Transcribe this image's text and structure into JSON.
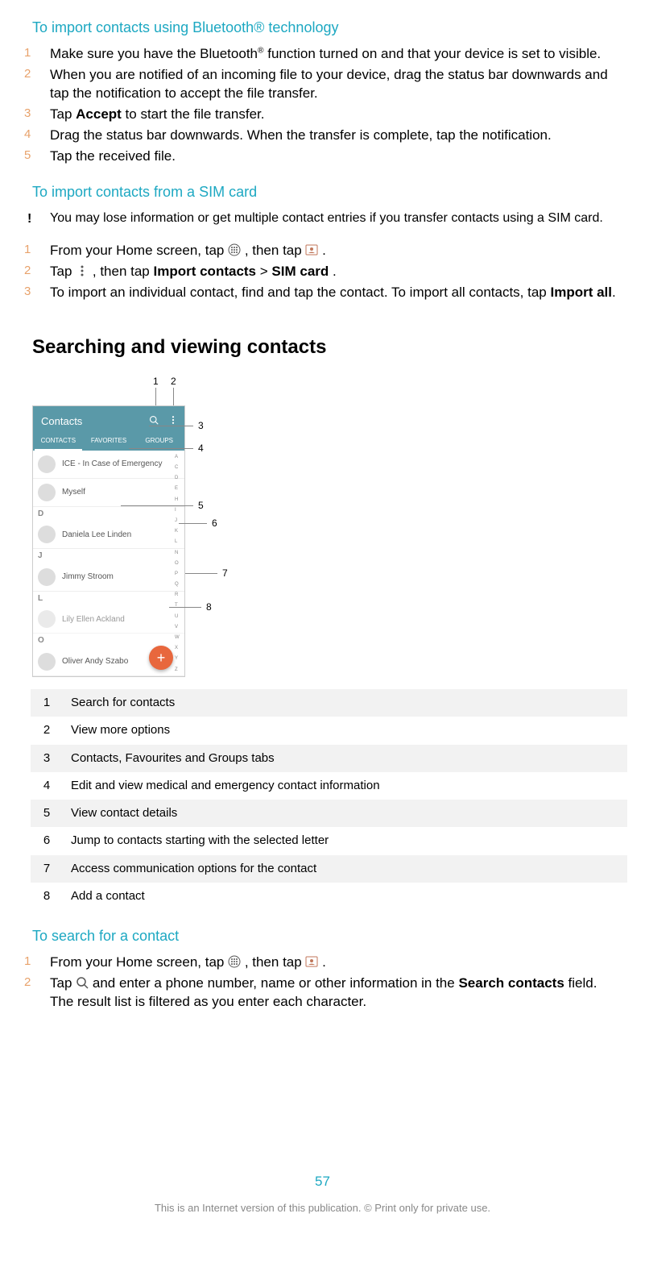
{
  "heading_bluetooth": "To import contacts using Bluetooth® technology",
  "bluetooth_steps": {
    "s1a": "Make sure you have the Bluetooth",
    "s1sup": "®",
    "s1b": " function turned on and that your device is set to visible.",
    "s2": "When you are notified of an incoming file to your device, drag the status bar downwards and tap the notification to accept the file transfer.",
    "s3a": "Tap ",
    "s3bold": "Accept",
    "s3b": " to start the file transfer.",
    "s4": "Drag the status bar downwards. When the transfer is complete, tap the notification.",
    "s5": "Tap the received file."
  },
  "heading_sim": "To import contacts from a SIM card",
  "sim_warning": "You may lose information or get multiple contact entries if you transfer contacts using a SIM card.",
  "sim_steps": {
    "s1a": "From your Home screen, tap ",
    "s1b": ", then tap ",
    "s1c": ".",
    "s2a": "Tap ",
    "s2b": ", then tap ",
    "s2bold1": "Import contacts",
    "s2gt": " > ",
    "s2bold2": "SIM card",
    "s2c": ".",
    "s3a": "To import an individual contact, find and tap the contact. To import all contacts, tap ",
    "s3bold": "Import all",
    "s3b": "."
  },
  "section_heading": "Searching and viewing contacts",
  "phone_ui": {
    "header_title": "Contacts",
    "tabs": [
      "CONTACTS",
      "FAVORITES",
      "GROUPS"
    ],
    "ice_label": "ICE - In Case of Emergency",
    "myself": "Myself",
    "letter_d": "D",
    "daniela": "Daniela Lee Linden",
    "letter_j": "J",
    "jimmy": "Jimmy Stroom",
    "letter_l": "L",
    "lily": "Lily Ellen Ackland",
    "letter_o": "O",
    "oliver": "Oliver Andy Szabo",
    "fab": "+",
    "alpha": [
      "A",
      "C",
      "D",
      "E",
      "H",
      "I",
      "J",
      "K",
      "L",
      "N",
      "O",
      "P",
      "Q",
      "R",
      "T",
      "U",
      "V",
      "W",
      "X",
      "Y",
      "Z"
    ]
  },
  "callouts": {
    "c1": "1",
    "c2": "2",
    "c3": "3",
    "c4": "4",
    "c5": "5",
    "c6": "6",
    "c7": "7",
    "c8": "8"
  },
  "legend": {
    "r1": {
      "n": "1",
      "t": "Search for contacts"
    },
    "r2": {
      "n": "2",
      "t": "View more options"
    },
    "r3": {
      "n": "3",
      "t": "Contacts, Favourites and Groups tabs"
    },
    "r4": {
      "n": "4",
      "t": "Edit and view medical and emergency contact information"
    },
    "r5": {
      "n": "5",
      "t": "View contact details"
    },
    "r6": {
      "n": "6",
      "t": "Jump to contacts starting with the selected letter"
    },
    "r7": {
      "n": "7",
      "t": "Access communication options for the contact"
    },
    "r8": {
      "n": "8",
      "t": "Add a contact"
    }
  },
  "heading_search": "To search for a contact",
  "search_steps": {
    "s1a": "From your Home screen, tap ",
    "s1b": ", then tap ",
    "s1c": ".",
    "s2a": "Tap ",
    "s2b": " and enter a phone number, name or other information in the ",
    "s2bold": "Search contacts",
    "s2c": " field. The result list is filtered as you enter each character."
  },
  "footer": {
    "page": "57",
    "note": "This is an Internet version of this publication. © Print only for private use."
  }
}
